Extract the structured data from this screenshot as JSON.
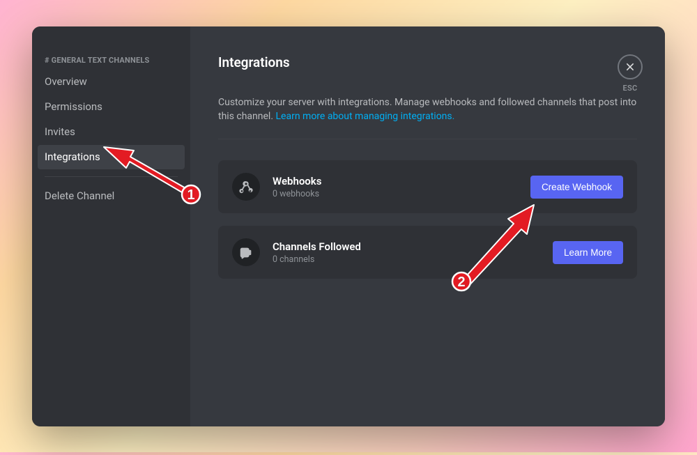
{
  "sidebar": {
    "heading": "# GENERAL TEXT CHANNELS",
    "items": [
      {
        "label": "Overview"
      },
      {
        "label": "Permissions"
      },
      {
        "label": "Invites"
      },
      {
        "label": "Integrations",
        "selected": true
      },
      {
        "label": "Delete Channel",
        "separated": true
      }
    ]
  },
  "close": {
    "label": "ESC"
  },
  "page": {
    "title": "Integrations",
    "description_text": "Customize your server with integrations. Manage webhooks and followed channels that post into this channel. ",
    "learn_more_link": "Learn more about managing integrations."
  },
  "cards": [
    {
      "icon": "webhook-icon",
      "title": "Webhooks",
      "subtitle": "0 webhooks",
      "button_label": "Create Webhook"
    },
    {
      "icon": "channels-followed-icon",
      "title": "Channels Followed",
      "subtitle": "0 channels",
      "button_label": "Learn More"
    }
  ],
  "annotations": {
    "labels": [
      "1",
      "2"
    ]
  },
  "colors": {
    "accent": "#5865f2",
    "link": "#00aff4",
    "annotation": "#e31b23",
    "bg_window_dark": "#2f3136",
    "bg_content": "#36393f"
  }
}
